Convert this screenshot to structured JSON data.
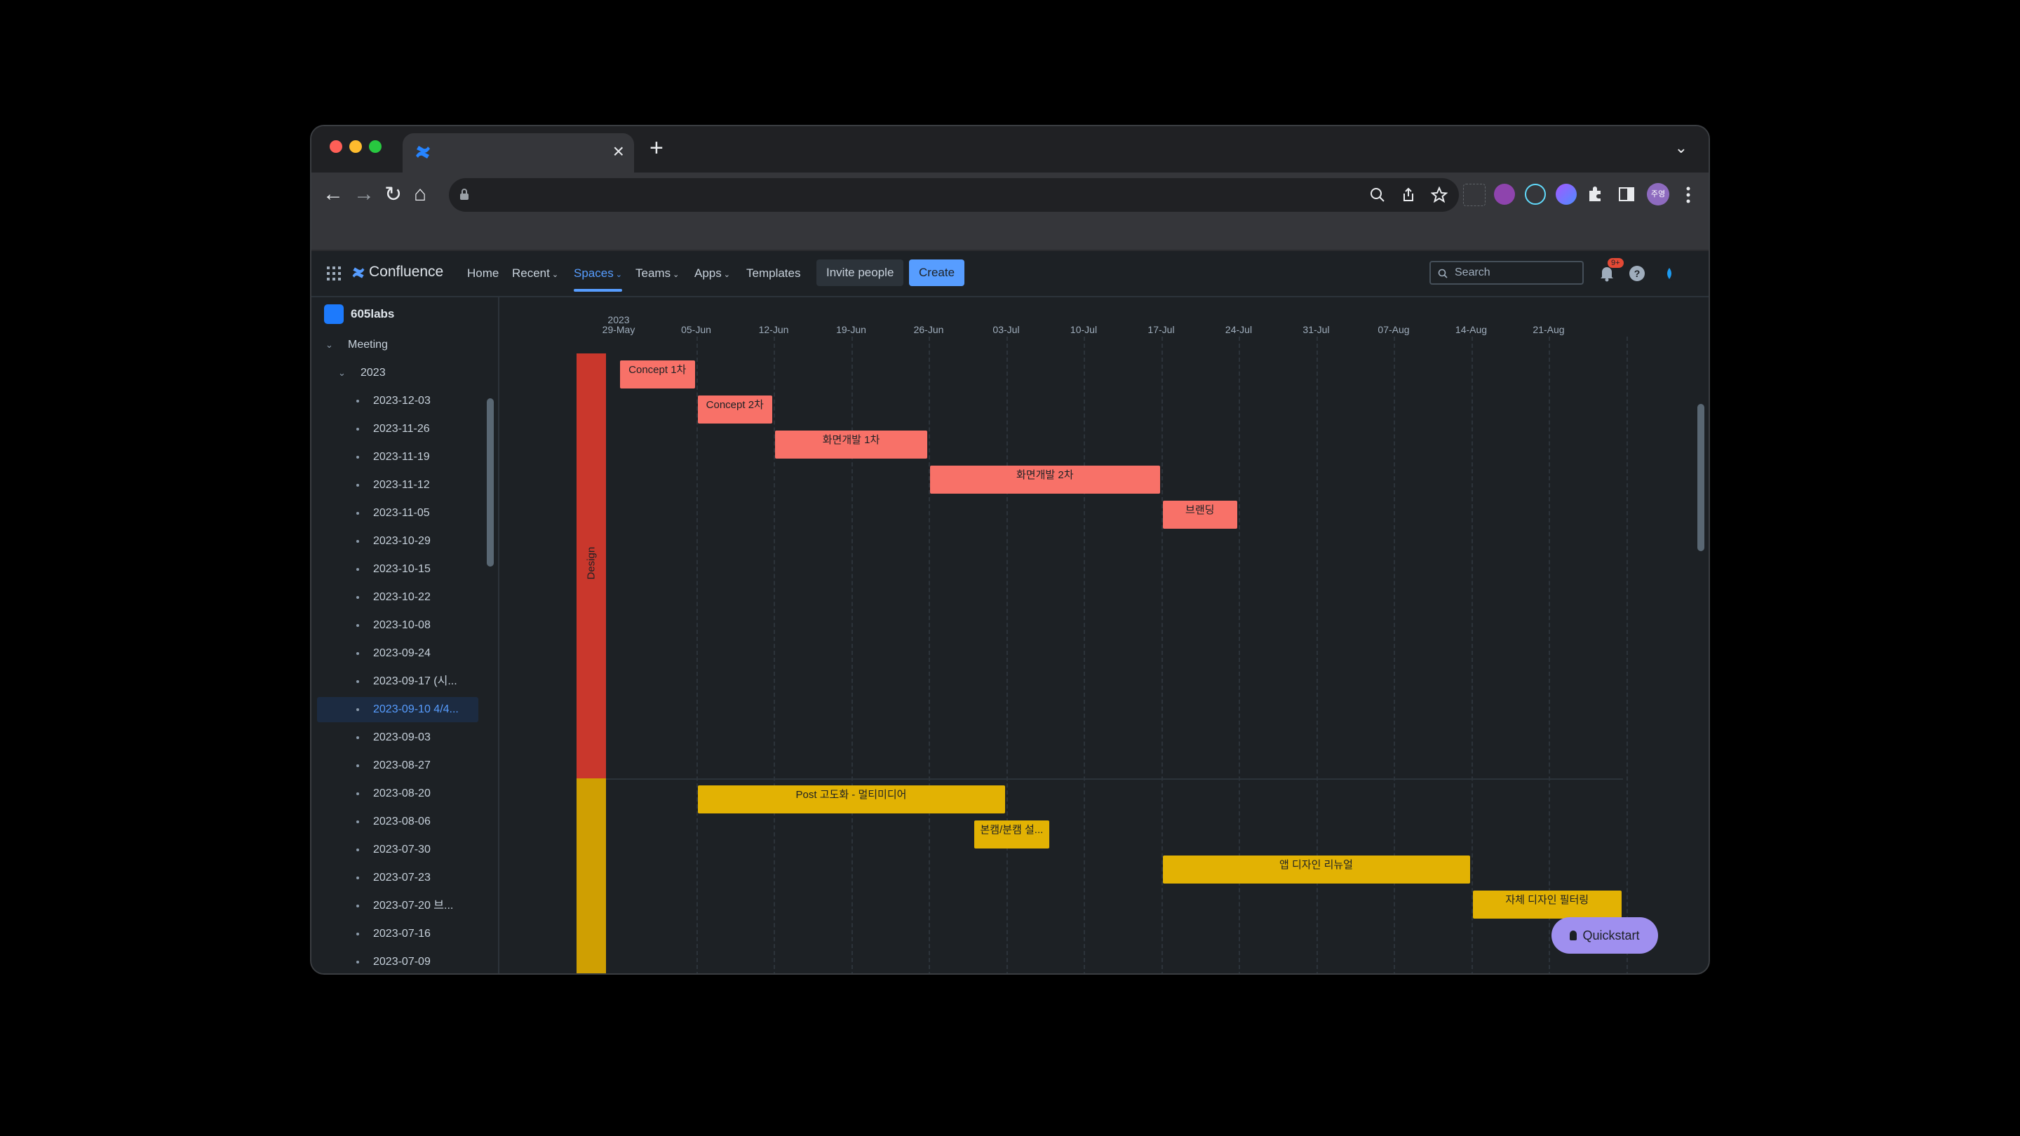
{
  "browser": {
    "tab_close": "×",
    "new_tab": "+",
    "tab_menu": "⌄",
    "back": "←",
    "forward": "→",
    "reload": "↻",
    "home": "⌂",
    "profile_initials": "주영"
  },
  "app": {
    "logo_text": "Confluence",
    "nav": {
      "home": "Home",
      "recent": "Recent",
      "spaces": "Spaces",
      "teams": "Teams",
      "apps": "Apps",
      "templates": "Templates"
    },
    "invite_label": "Invite people",
    "create_label": "Create",
    "search_placeholder": "Search",
    "notification_badge": "9+"
  },
  "sidebar": {
    "space_name": "605labs",
    "meeting_label": "Meeting",
    "year_label": "2023",
    "pages": [
      "2023-12-03",
      "2023-11-26",
      "2023-11-19",
      "2023-11-12",
      "2023-11-05",
      "2023-10-29",
      "2023-10-15",
      "2023-10-22",
      "2023-10-08",
      "2023-09-24",
      "2023-09-17 (시...",
      "2023-09-10 4/4...",
      "2023-09-03",
      "2023-08-27",
      "2023-08-20",
      "2023-08-06",
      "2023-07-30",
      "2023-07-23",
      "2023-07-20 브...",
      "2023-07-16",
      "2023-07-09"
    ],
    "selected_index": 11
  },
  "timeline": {
    "year": "2023",
    "weeks": [
      "29-May",
      "05-Jun",
      "12-Jun",
      "19-Jun",
      "26-Jun",
      "03-Jul",
      "10-Jul",
      "17-Jul",
      "24-Jul",
      "31-Jul",
      "07-Aug",
      "14-Aug",
      "21-Aug"
    ],
    "groups": [
      {
        "label": "Design",
        "color": "#c9372c"
      },
      {
        "label": "",
        "color": "#cf9f02"
      }
    ],
    "bars": [
      {
        "label": "Concept 1차",
        "group": 0,
        "start": "2023-05-29",
        "end": "2023-06-04"
      },
      {
        "label": "Concept 2차",
        "group": 0,
        "start": "2023-06-05",
        "end": "2023-06-11"
      },
      {
        "label": "화면개발 1차",
        "group": 0,
        "start": "2023-06-12",
        "end": "2023-06-25"
      },
      {
        "label": "화면개발 2차",
        "group": 0,
        "start": "2023-06-26",
        "end": "2023-07-16"
      },
      {
        "label": "브랜딩",
        "group": 0,
        "start": "2023-07-17",
        "end": "2023-07-23"
      },
      {
        "label": "Post 고도화 - 멀티미디어",
        "group": 1,
        "start": "2023-06-05",
        "end": "2023-07-02"
      },
      {
        "label": "본캠/분캠 설...",
        "group": 1,
        "start": "2023-06-30",
        "end": "2023-07-06"
      },
      {
        "label": "앱 디자인 리뉴얼",
        "group": 1,
        "start": "2023-07-17",
        "end": "2023-08-13"
      },
      {
        "label": "자체 디자인 필터링",
        "group": 1,
        "start": "2023-08-14",
        "end": "2023-08-27"
      }
    ]
  },
  "quickstart_label": "Quickstart"
}
